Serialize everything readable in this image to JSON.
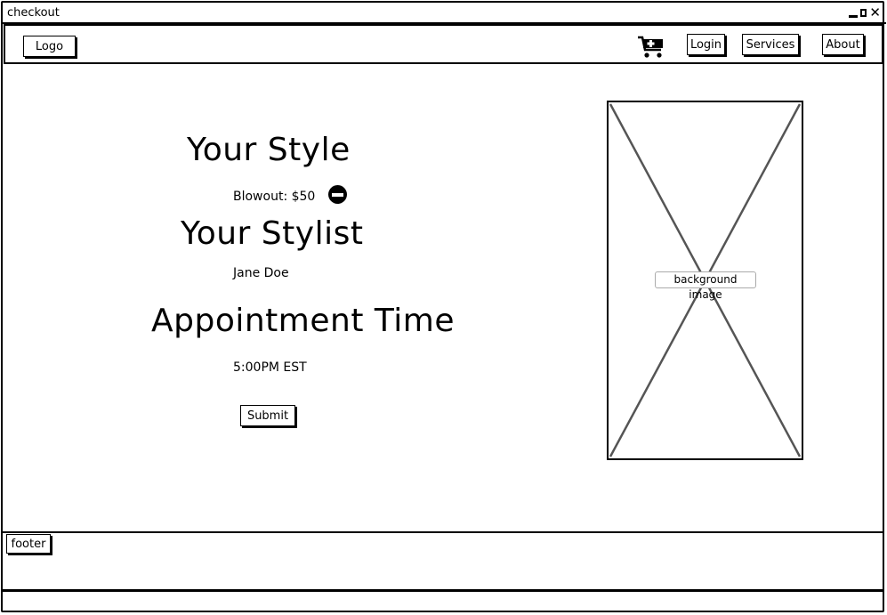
{
  "window": {
    "title": "checkout",
    "close_glyph": "✕"
  },
  "nav": {
    "logo_label": "Logo",
    "cart_icon": "cart-add-icon",
    "login_label": "Login",
    "services_label": "Services",
    "about_label": "About"
  },
  "main": {
    "style_heading": "Your Style",
    "style_item": "Blowout: $50",
    "remove_icon": "remove-icon",
    "stylist_heading": "Your Stylist",
    "stylist_name": "Jane Doe",
    "appointment_heading": "Appointment Time",
    "appointment_time": "5:00PM EST",
    "submit_label": "Submit"
  },
  "image_placeholder": {
    "label": "background image"
  },
  "footer": {
    "label": "footer"
  }
}
